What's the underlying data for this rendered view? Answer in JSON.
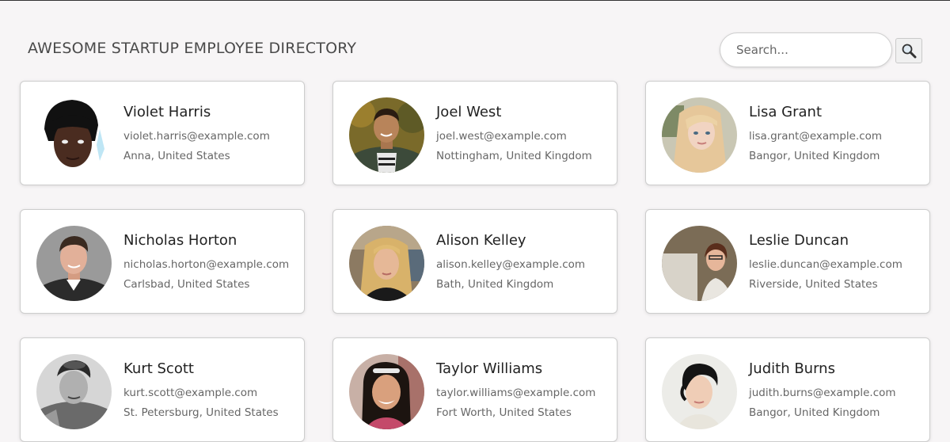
{
  "header": {
    "title": "AWESOME STARTUP EMPLOYEE DIRECTORY",
    "search_placeholder": "Search...",
    "search_icon": "magnifier-icon"
  },
  "employees": [
    {
      "name": "Violet Harris",
      "email": "violet.harris@example.com",
      "location": "Anna, United States"
    },
    {
      "name": "Joel West",
      "email": "joel.west@example.com",
      "location": "Nottingham, United Kingdom"
    },
    {
      "name": "Lisa Grant",
      "email": "lisa.grant@example.com",
      "location": "Bangor, United Kingdom"
    },
    {
      "name": "Nicholas Horton",
      "email": "nicholas.horton@example.com",
      "location": "Carlsbad, United States"
    },
    {
      "name": "Alison Kelley",
      "email": "alison.kelley@example.com",
      "location": "Bath, United Kingdom"
    },
    {
      "name": "Leslie Duncan",
      "email": "leslie.duncan@example.com",
      "location": "Riverside, United States"
    },
    {
      "name": "Kurt Scott",
      "email": "kurt.scott@example.com",
      "location": "St. Petersburg, United States"
    },
    {
      "name": "Taylor Williams",
      "email": "taylor.williams@example.com",
      "location": "Fort Worth, United States"
    },
    {
      "name": "Judith Burns",
      "email": "judith.burns@example.com",
      "location": "Bangor, United Kingdom"
    }
  ]
}
